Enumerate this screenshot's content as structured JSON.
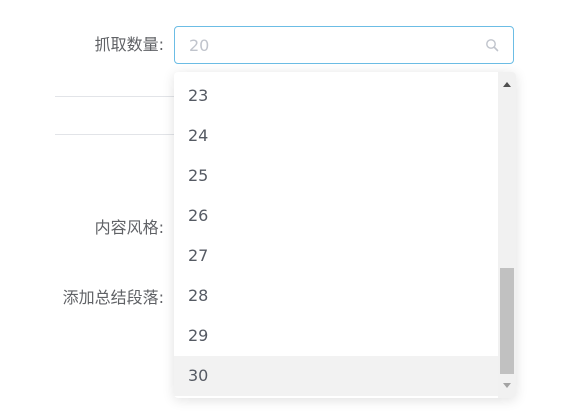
{
  "form": {
    "count_label": "抓取数量:",
    "style_label": "内容风格:",
    "summary_label": "添加总结段落:"
  },
  "select": {
    "value": "20",
    "icon": "search-icon",
    "accent_color": "#6cbde5"
  },
  "dropdown": {
    "options": [
      "23",
      "24",
      "25",
      "26",
      "27",
      "28",
      "29",
      "30"
    ],
    "hovered_option": "30"
  }
}
